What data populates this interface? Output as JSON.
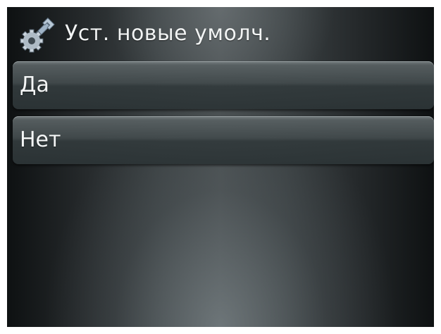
{
  "header": {
    "title": "Уст. новые умолч.",
    "icon": "wrench-gear-icon"
  },
  "menu": {
    "items": [
      {
        "label": "Да"
      },
      {
        "label": "Нет"
      }
    ]
  },
  "colors": {
    "background_center": "#4a5052",
    "background_edge": "#0e1112",
    "item_top": "#78807f",
    "item_bottom": "#2c3436",
    "text": "#f2f4f4"
  }
}
